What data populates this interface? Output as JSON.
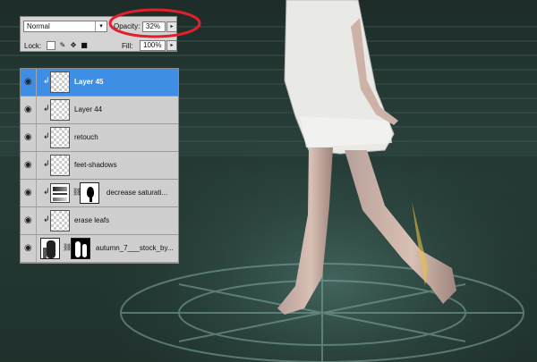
{
  "options_bar": {
    "blend_mode": "Normal",
    "opacity_label": "Opacity:",
    "opacity_value": "32%",
    "lock_label": "Lock:",
    "fill_label": "Fill:",
    "fill_value": "100%"
  },
  "layers": [
    {
      "name": "Layer 45",
      "selected": true,
      "kind": "pixel",
      "clipped": true
    },
    {
      "name": "Layer 44",
      "selected": false,
      "kind": "pixel",
      "clipped": true
    },
    {
      "name": "retouch",
      "selected": false,
      "kind": "pixel",
      "clipped": true
    },
    {
      "name": "feet-shadows",
      "selected": false,
      "kind": "pixel",
      "clipped": true
    },
    {
      "name": "decrease saturati...",
      "selected": false,
      "kind": "adjustment",
      "clipped": true
    },
    {
      "name": "erase leafs",
      "selected": false,
      "kind": "pixel",
      "clipped": true
    },
    {
      "name": "autumn_7___stock_by...",
      "selected": false,
      "kind": "image-with-mask",
      "clipped": false
    }
  ],
  "colors": {
    "selection": "#3d8ee4",
    "annotation_ring": "#e0202a",
    "background_teal": "#243833"
  },
  "icons": [
    "eye-icon",
    "clip-arrow-icon",
    "chain-link-icon",
    "lock-transparent-icon",
    "lock-brush-icon",
    "lock-move-icon",
    "lock-all-icon",
    "dropdown-arrow-icon"
  ]
}
